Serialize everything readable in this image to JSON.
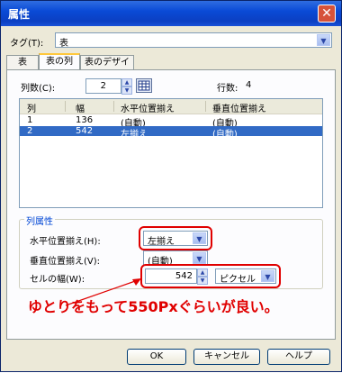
{
  "window": {
    "title": "属性",
    "close_glyph": "✕"
  },
  "tag": {
    "label": "タグ(T):",
    "value": "表"
  },
  "tabs": [
    {
      "label": "表"
    },
    {
      "label": "表の列"
    },
    {
      "label": "表のデザイン"
    }
  ],
  "columns": {
    "label": "列数(C):",
    "value": "2",
    "rows_label": "行数:",
    "rows_value": "4"
  },
  "list": {
    "headers": [
      "列",
      "幅",
      "水平位置揃え",
      "垂直位置揃え"
    ],
    "rows": [
      {
        "col": "1",
        "width": "136",
        "halign": "(自動)",
        "valign": "(自動)"
      },
      {
        "col": "2",
        "width": "542",
        "halign": "左揃え",
        "valign": "(自動)"
      }
    ]
  },
  "props": {
    "group_label": "列属性",
    "halign_label": "水平位置揃え(H):",
    "halign_value": "左揃え",
    "valign_label": "垂直位置揃え(V):",
    "valign_value": "(自動)",
    "width_label": "セルの幅(W):",
    "width_value": "542",
    "unit_value": "ピクセル"
  },
  "annotation": "ゆとりをもって550Pxぐらいが良い。",
  "buttons": {
    "ok": "OK",
    "cancel": "キャンセル",
    "help": "ヘルプ"
  },
  "colors": {
    "title_bar": "#0a4ad6",
    "selection": "#316ac5",
    "annotation": "#e00000"
  }
}
